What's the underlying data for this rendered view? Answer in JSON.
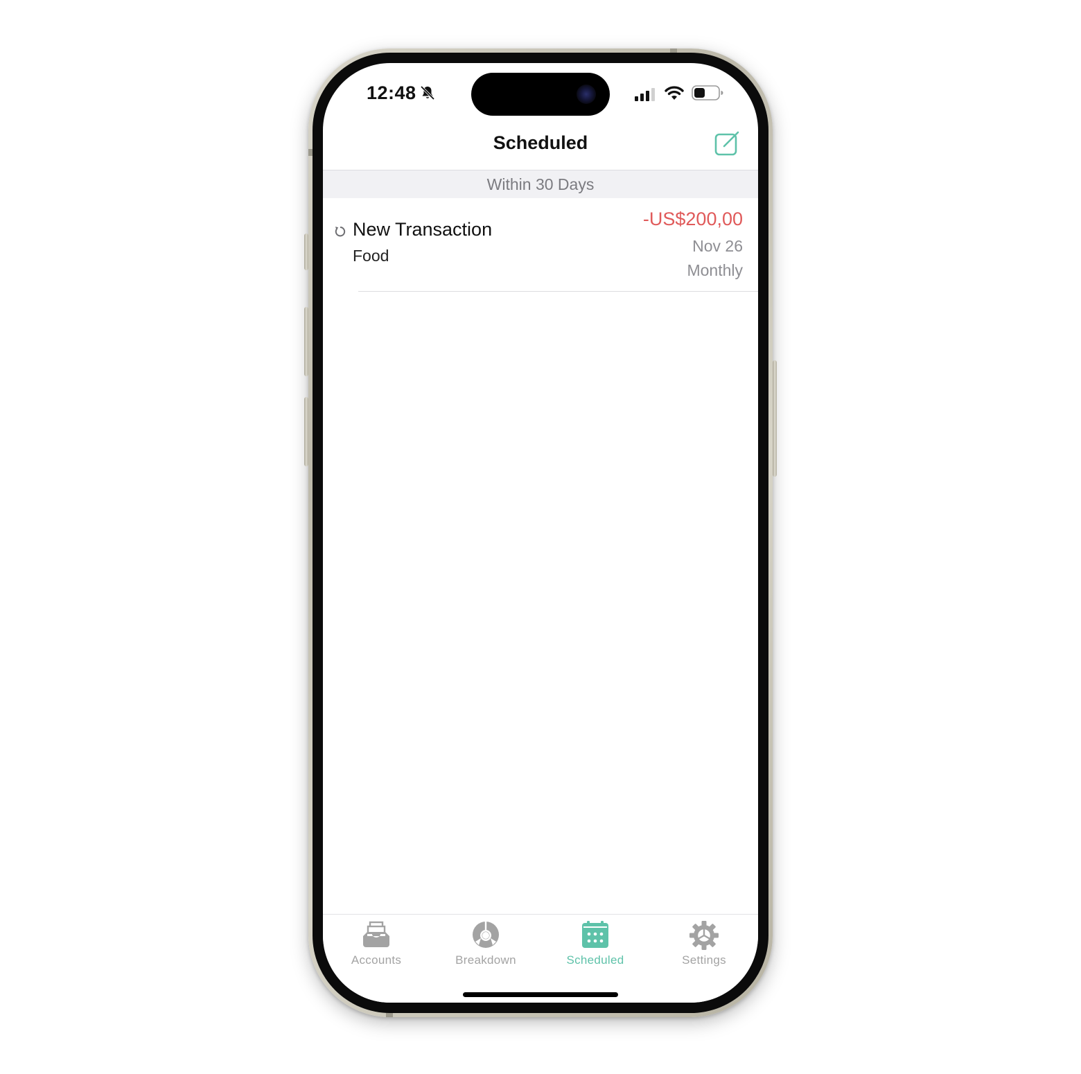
{
  "status_bar": {
    "time": "12:48",
    "icons": [
      "bell-slash-icon",
      "cellular-signal-icon",
      "wifi-icon",
      "battery-icon"
    ]
  },
  "nav": {
    "title": "Scheduled",
    "compose_icon": "compose-icon"
  },
  "section": {
    "header": "Within 30 Days"
  },
  "transactions": [
    {
      "icon": "repeat-icon",
      "title": "New Transaction",
      "category": "Food",
      "amount": "-US$200,00",
      "date": "Nov 26",
      "frequency": "Monthly"
    }
  ],
  "tabs": [
    {
      "label": "Accounts",
      "icon": "tray-icon",
      "active": false
    },
    {
      "label": "Breakdown",
      "icon": "pie-chart-icon",
      "active": false
    },
    {
      "label": "Scheduled",
      "icon": "calendar-icon",
      "active": true
    },
    {
      "label": "Settings",
      "icon": "gear-icon",
      "active": false
    }
  ],
  "colors": {
    "accent": "#5ec2a9",
    "negative_amount": "#e05a5a",
    "secondary_text": "#8e8e93",
    "inactive_tab": "#a3a3a3",
    "section_bg": "#f1f1f4"
  }
}
